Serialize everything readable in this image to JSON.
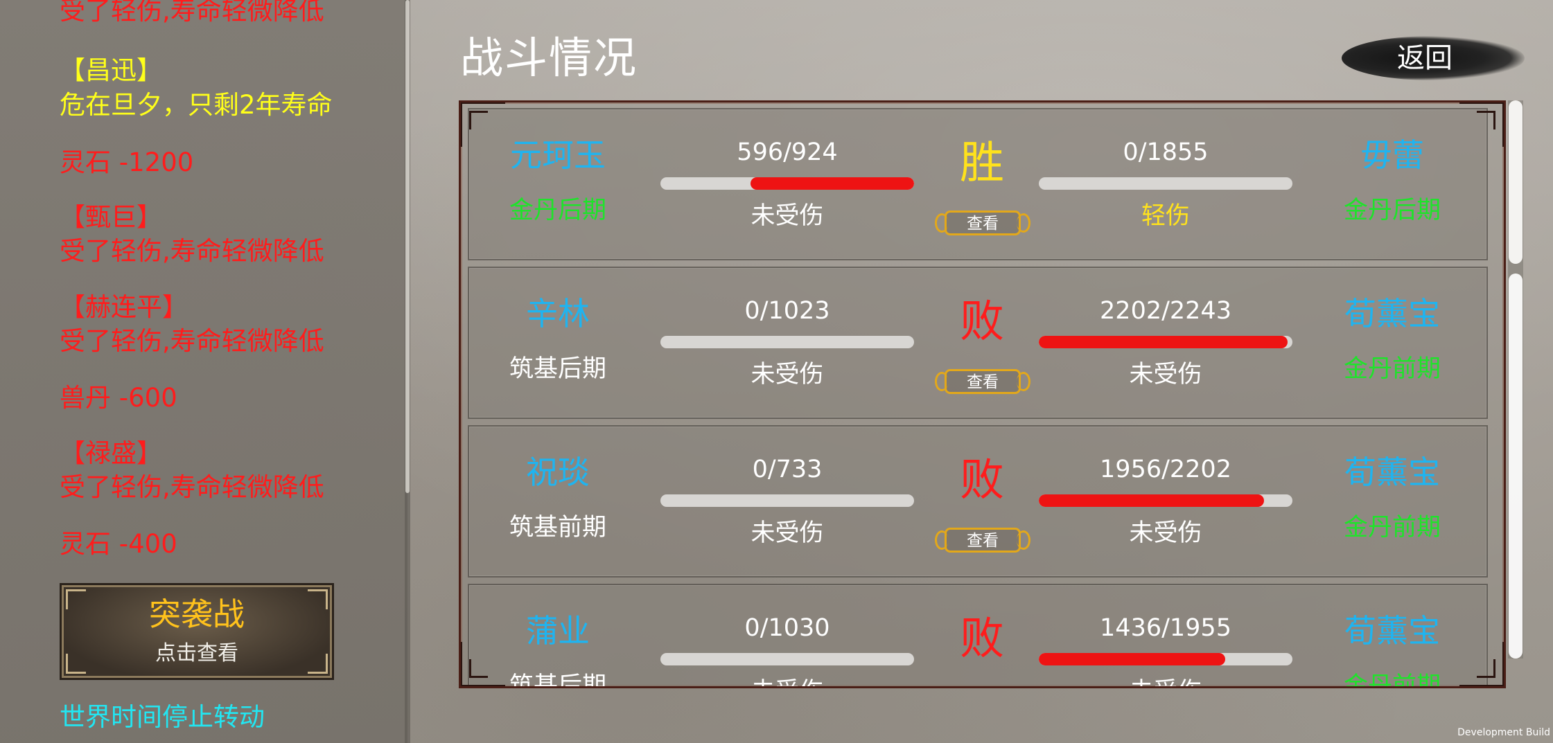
{
  "log_panel": {
    "lines": [
      {
        "text": "受了轻伤,寿命轻微降低",
        "color": "#ff1c1c"
      },
      {
        "text": "【昌迅】",
        "color": "#ffff1a"
      },
      {
        "text": "危在旦夕，只剩2年寿命",
        "color": "#ffff1a"
      },
      {
        "text": "灵石 -1200",
        "color": "#ff1c1c"
      },
      {
        "text": "【甄巨】",
        "color": "#ff1c1c"
      },
      {
        "text": "受了轻伤,寿命轻微降低",
        "color": "#ff1c1c"
      },
      {
        "text": "【赫连平】",
        "color": "#ff1c1c"
      },
      {
        "text": "受了轻伤,寿命轻微降低",
        "color": "#ff1c1c"
      },
      {
        "text": "兽丹 -600",
        "color": "#ff1c1c"
      },
      {
        "text": "【禄盛】",
        "color": "#ff1c1c"
      },
      {
        "text": "受了轻伤,寿命轻微降低",
        "color": "#ff1c1c"
      },
      {
        "text": "灵石 -400",
        "color": "#ff1c1c"
      }
    ],
    "raid_button": {
      "title": "突袭战",
      "subtitle": "点击查看"
    },
    "world_time_text": "世界时间停止转动"
  },
  "header": {
    "title": "战斗情况",
    "back_label": "返回"
  },
  "battles": [
    {
      "left": {
        "name": "元珂玉",
        "realm": "金丹后期",
        "realm_color": "#1ee42a",
        "hp_text": "596/924",
        "hp_fraction": 0.645,
        "status": "未受伤",
        "status_color": "#ffffff"
      },
      "result": "胜",
      "result_color": "#ffe21c",
      "view_label": "查看",
      "right": {
        "name": "毋蕾",
        "realm": "金丹后期",
        "realm_color": "#1ee42a",
        "hp_text": "0/1855",
        "hp_fraction": 0.0,
        "status": "轻伤",
        "status_color": "#ffe21c"
      }
    },
    {
      "left": {
        "name": "辛林",
        "realm": "筑基后期",
        "realm_color": "#ffffff",
        "hp_text": "0/1023",
        "hp_fraction": 0.0,
        "status": "未受伤",
        "status_color": "#ffffff"
      },
      "result": "败",
      "result_color": "#ff1c1c",
      "view_label": "查看",
      "right": {
        "name": "荀薰宝",
        "realm": "金丹前期",
        "realm_color": "#1ee42a",
        "hp_text": "2202/2243",
        "hp_fraction": 0.982,
        "status": "未受伤",
        "status_color": "#ffffff"
      }
    },
    {
      "left": {
        "name": "祝琰",
        "realm": "筑基前期",
        "realm_color": "#ffffff",
        "hp_text": "0/733",
        "hp_fraction": 0.0,
        "status": "未受伤",
        "status_color": "#ffffff"
      },
      "result": "败",
      "result_color": "#ff1c1c",
      "view_label": "查看",
      "right": {
        "name": "荀薰宝",
        "realm": "金丹前期",
        "realm_color": "#1ee42a",
        "hp_text": "1956/2202",
        "hp_fraction": 0.888,
        "status": "未受伤",
        "status_color": "#ffffff"
      }
    },
    {
      "left": {
        "name": "蒲业",
        "realm": "筑基后期",
        "realm_color": "#ffffff",
        "hp_text": "0/1030",
        "hp_fraction": 0.0,
        "status": "未受伤",
        "status_color": "#ffffff"
      },
      "result": "败",
      "result_color": "#ff1c1c",
      "view_label": "查看",
      "right": {
        "name": "荀薰宝",
        "realm": "金丹前期",
        "realm_color": "#1ee42a",
        "hp_text": "1436/1955",
        "hp_fraction": 0.735,
        "status": "未受伤",
        "status_color": "#ffffff"
      }
    }
  ],
  "footer": {
    "dev_build": "Development Build"
  }
}
